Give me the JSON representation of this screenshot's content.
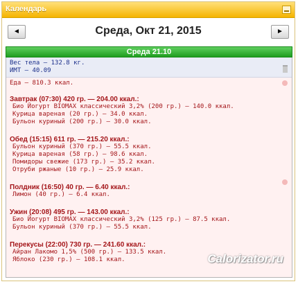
{
  "widget": {
    "title": "Календарь"
  },
  "nav": {
    "prev_label": "◄",
    "next_label": "►",
    "date_title": "Среда, Окт 21, 2015"
  },
  "day": {
    "header": "Среда 21.10",
    "weight": {
      "body_weight": "Вес тела — 132.8 кг.",
      "bmi": "ИМТ — 40.09"
    },
    "food_total": "Еда — 810.3 ккал.",
    "meals": [
      {
        "title": "Завтрак (07:30) 420 гр. — 204.00 ккал.:",
        "items": [
          "Био Йогурт BIOMAX классический 3,2% (200 гр.) — 140.0 ккал.",
          "Курица вареная (20 гр.) — 34.0 ккал.",
          "Бульон куриный (200 гр.) — 30.0 ккал."
        ]
      },
      {
        "title": "Обед (15:15) 611 гр. — 215.20 ккал.:",
        "items": [
          "Бульон куриный (370 гр.) — 55.5 ккал.",
          "Курица вареная (58 гр.) — 98.6 ккал.",
          "Помидоры свежие (173 гр.) — 35.2 ккал.",
          "Отруби ржаные (10 гр.) — 25.9 ккал."
        ]
      },
      {
        "title": "Полдник (16:50) 40 гр. — 6.40 ккал.:",
        "items": [
          "Лимон (40 гр.) — 6.4 ккал."
        ]
      },
      {
        "title": "Ужин (20:08) 495 гр. — 143.00 ккал.:",
        "items": [
          "Био Йогурт BIOMAX классический 3,2% (125 гр.) — 87.5 ккал.",
          "Бульон куриный (370 гр.) — 55.5 ккал."
        ]
      },
      {
        "title": "Перекусы (22:00) 730 гр. — 241.60 ккал.:",
        "items": [
          "Айран Лакомо 1,5% (500 гр.) — 133.5 ккал.",
          "Яблоко (230 гр.) — 108.1 ккал."
        ]
      }
    ]
  },
  "watermark": "Calorizator.ru",
  "colors": {
    "title_bar": "#f5b400",
    "day_header": "#1f9d1f",
    "food_text": "#a4161a",
    "weight_text": "#1a2e8a"
  }
}
